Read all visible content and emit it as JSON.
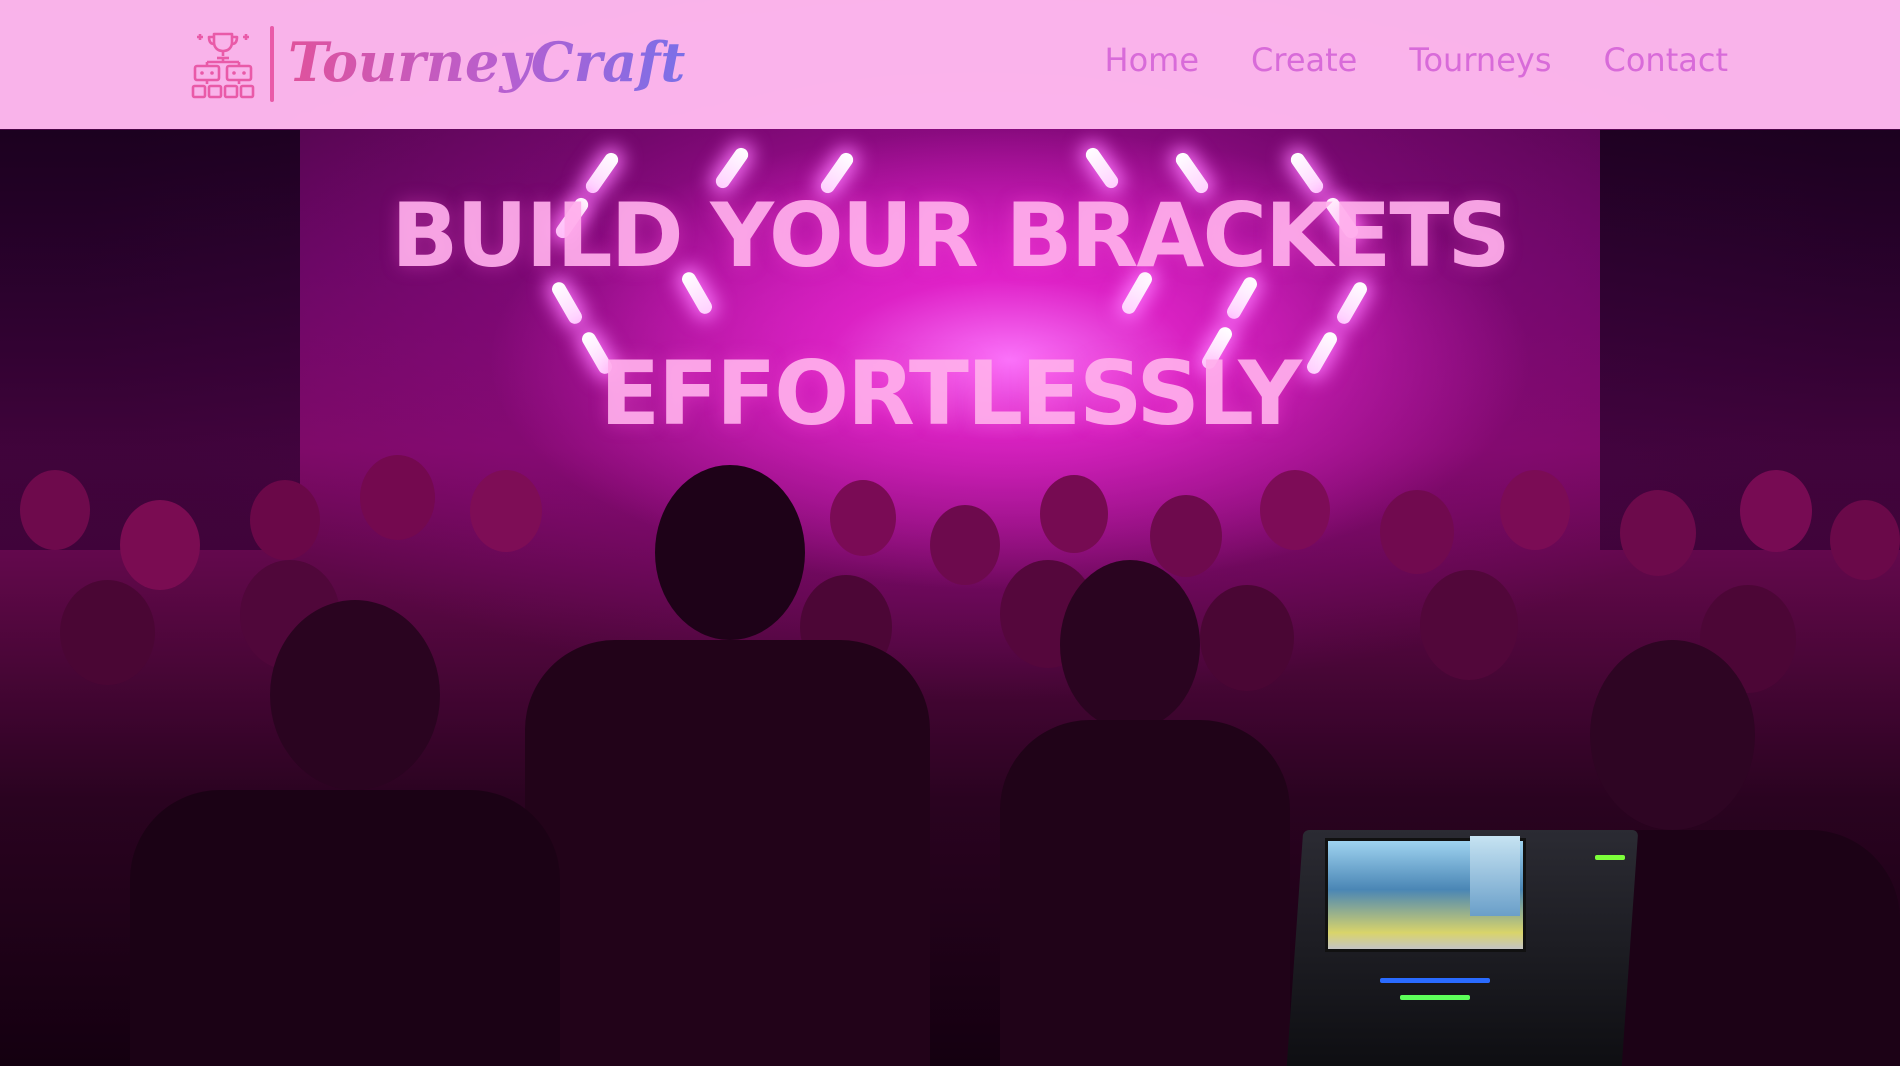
{
  "header": {
    "logo_text": "TourneyCraft",
    "logo_icon": "tournament-bracket-trophy-icon",
    "nav": [
      {
        "label": "Home"
      },
      {
        "label": "Create"
      },
      {
        "label": "Tourneys"
      },
      {
        "label": "Contact"
      }
    ]
  },
  "hero": {
    "title_line1": "BUILD YOUR BRACKETS",
    "title_line2": "EFFORTLESSLY",
    "background_image": "concert-crowd-stage-lights"
  },
  "colors": {
    "header_bg": "#ffb9f0",
    "nav_text": "#d86bd9",
    "logo_gradient_start": "#e0529c",
    "logo_gradient_end": "#7a6fe8",
    "hero_title": "#ffafeb",
    "accent_magenta": "#e628d2"
  }
}
